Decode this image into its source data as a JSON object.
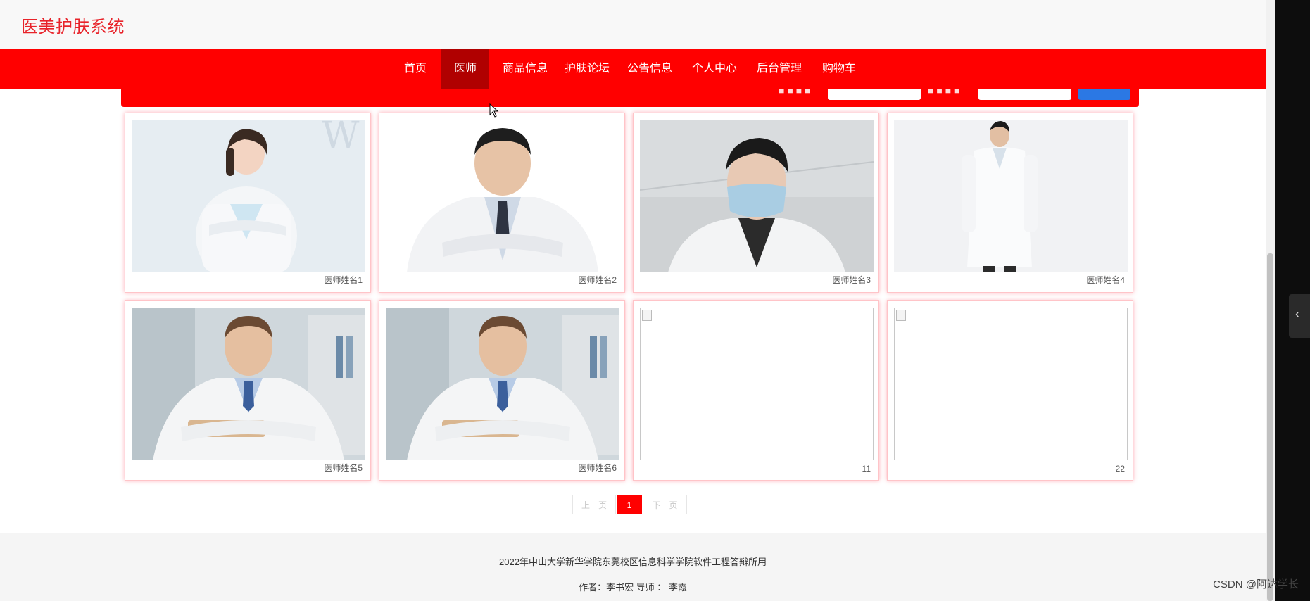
{
  "site": {
    "title": "医美护肤系统"
  },
  "nav": {
    "items": [
      {
        "label": "首页"
      },
      {
        "label": "医师",
        "active": true
      },
      {
        "label": "商品信息"
      },
      {
        "label": "护肤论坛"
      },
      {
        "label": "公告信息"
      },
      {
        "label": "个人中心"
      },
      {
        "label": "后台管理"
      },
      {
        "label": "购物车"
      }
    ]
  },
  "doctors": [
    {
      "name": "医师姓名1",
      "image": "female-doctor-photo"
    },
    {
      "name": "医师姓名2",
      "image": "male-doctor-arms-crossed-photo"
    },
    {
      "name": "医师姓名3",
      "image": "masked-doctor-photo"
    },
    {
      "name": "医师姓名4",
      "image": "doctor-full-coat-photo"
    },
    {
      "name": "医师姓名5",
      "image": "smiling-doctor-photo"
    },
    {
      "name": "医师姓名6",
      "image": "smiling-doctor-photo"
    },
    {
      "name": "11",
      "image": "broken-image"
    },
    {
      "name": "22",
      "image": "broken-image"
    }
  ],
  "pagination": {
    "prev": "上一页",
    "current": "1",
    "next": "下一页"
  },
  "footer": {
    "line1": "2022年中山大学新华学院东莞校区信息科学学院软件工程答辩所用",
    "line2": "作者：李书宏 导师 ： 李霞"
  },
  "watermark": "CSDN @阿达学长",
  "colors": {
    "brand_red": "#ff0000",
    "active_nav": "#b00000",
    "search_button": "#2b78e4"
  }
}
